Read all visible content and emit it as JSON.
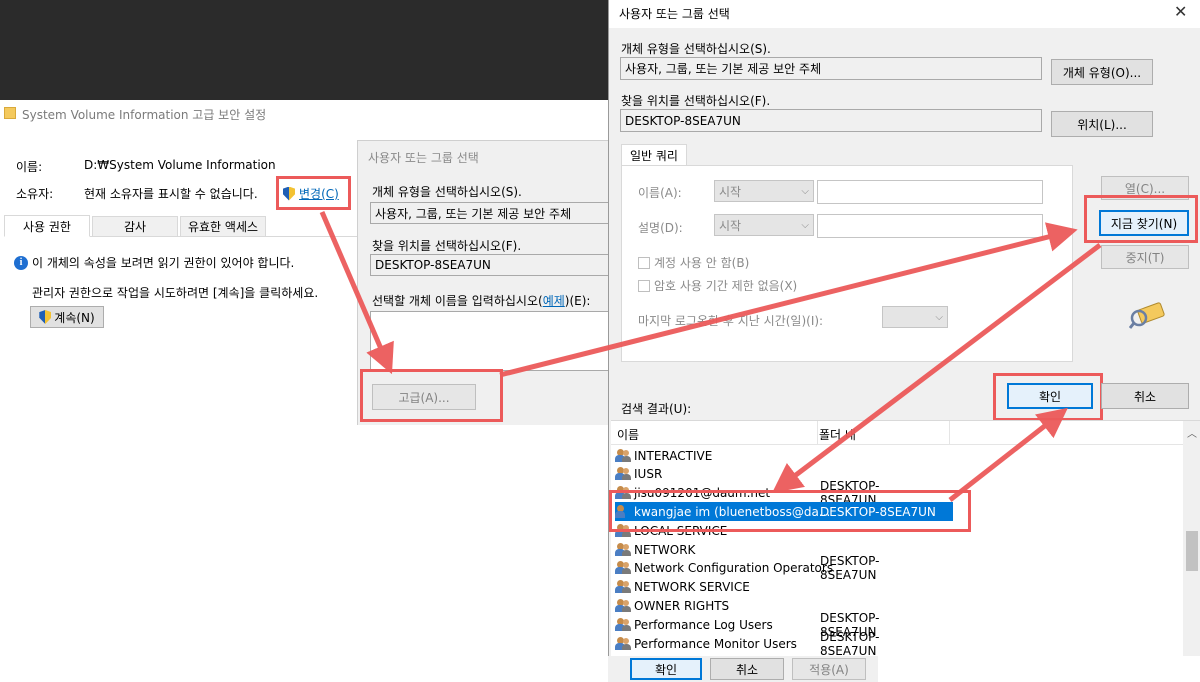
{
  "win1": {
    "title": "System Volume Information 고급 보안 설정",
    "name_label": "이름:",
    "name_value": "D:₩System Volume Information",
    "owner_label": "소유자:",
    "owner_value": "현재 소유자를 표시할 수 없습니다.",
    "change_link": "변경(C)",
    "tabs": [
      "사용 권한",
      "감사",
      "유효한 액세스"
    ],
    "info_message": "이 개체의 속성을 보려면 읽기 권한이 있어야 합니다.",
    "admin_message": "관리자 권한으로 작업을 시도하려면 [계속]을 클릭하세요.",
    "continue_button": "계속(N)"
  },
  "win2": {
    "title": "사용자 또는 그룹 선택",
    "object_type_label": "개체 유형을 선택하십시오(S).",
    "object_type_value": "사용자, 그룹, 또는 기본 제공 보안 주체",
    "location_label": "찾을 위치를 선택하십시오(F).",
    "location_value": "DESKTOP-8SEA7UN",
    "enter_names_label": "선택할 개체 이름을 입력하십시오(",
    "examples_link": "예제",
    "enter_names_suffix": ")(E):",
    "advanced_button": "고급(A)..."
  },
  "win3": {
    "title": "사용자 또는 그룹 선택",
    "object_type_label": "개체 유형을 선택하십시오(S).",
    "object_type_value": "사용자, 그룹, 또는 기본 제공 보안 주체",
    "object_type_button": "개체 유형(O)...",
    "location_label": "찾을 위치를 선택하십시오(F).",
    "location_value": "DESKTOP-8SEA7UN",
    "location_button": "위치(L)...",
    "query_tab": "일반 쿼리",
    "name_label": "이름(A):",
    "desc_label": "설명(D):",
    "starts_with": "시작",
    "columns_button": "열(C)...",
    "find_now_button": "지금 찾기(N)",
    "stop_button": "중지(T)",
    "disabled_accounts": "계정 사용 안 함(B)",
    "non_expiring": "암호 사용 기간 제한 없음(X)",
    "days_since_logon": "마지막 로그온한 후 지난 시간(일)(I):",
    "ok_button": "확인",
    "cancel_button": "취소",
    "results_label": "검색 결과(U):",
    "columns": [
      "이름",
      "폴더 내"
    ],
    "results": [
      {
        "name": "INTERACTIVE",
        "folder": ""
      },
      {
        "name": "IUSR",
        "folder": ""
      },
      {
        "name": "jisu091201@daum.net",
        "folder": "DESKTOP-8SEA7UN"
      },
      {
        "name": "kwangjae im (bluenetboss@da...",
        "folder": "DESKTOP-8SEA7UN"
      },
      {
        "name": "LOCAL SERVICE",
        "folder": ""
      },
      {
        "name": "NETWORK",
        "folder": ""
      },
      {
        "name": "Network Configuration Operators",
        "folder": "DESKTOP-8SEA7UN"
      },
      {
        "name": "NETWORK SERVICE",
        "folder": ""
      },
      {
        "name": "OWNER RIGHTS",
        "folder": ""
      },
      {
        "name": "Performance Log Users",
        "folder": "DESKTOP-8SEA7UN"
      },
      {
        "name": "Performance Monitor Users",
        "folder": "DESKTOP-8SEA7UN"
      }
    ]
  },
  "bottom": {
    "ok": "확인",
    "cancel": "취소",
    "apply": "적용(A)"
  },
  "colors": {
    "annotation": "#ec5a5a",
    "selection": "#0078d7",
    "window_bg": "#f0f0f0"
  }
}
